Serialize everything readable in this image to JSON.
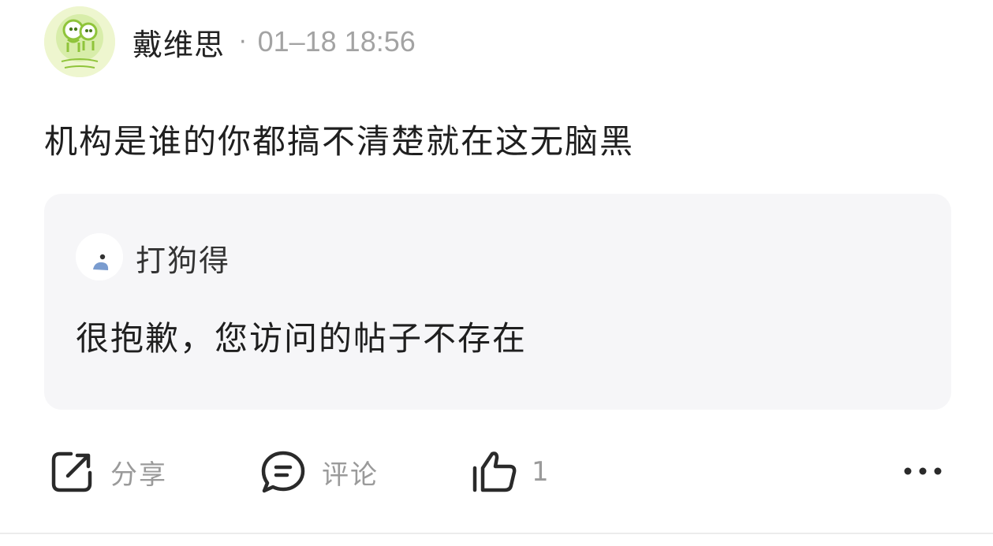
{
  "post": {
    "author": "戴维思",
    "separator": "·",
    "timestamp": "01–18 18:56",
    "text": "机构是谁的你都搞不清楚就在这无脑黑"
  },
  "quote": {
    "author": "打狗得",
    "text": "很抱歉，您访问的帖子不存在"
  },
  "actions": {
    "share_label": "分享",
    "comment_label": "评论",
    "like_count": "1"
  },
  "icons": [
    "share-icon",
    "comment-icon",
    "thumbs-up-icon",
    "more-icon"
  ],
  "colors": {
    "avatar_green": "#8fc43a",
    "quote_bg": "#f6f6f8",
    "muted_text": "#9a9a9a"
  }
}
